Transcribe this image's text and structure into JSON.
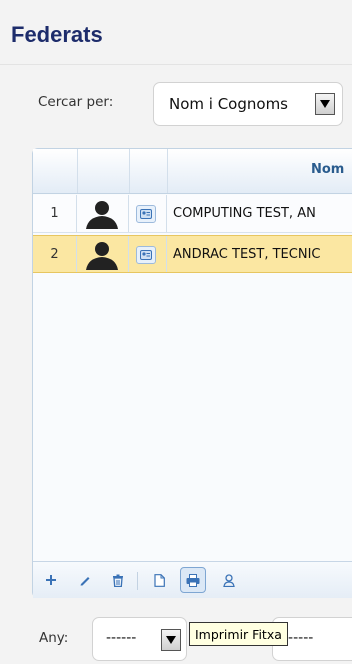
{
  "page": {
    "title": "Federats"
  },
  "search": {
    "label": "Cercar per:",
    "selected": "Nom i Cognoms"
  },
  "grid": {
    "column_header_name": "Nom",
    "rows": [
      {
        "num": "1",
        "name": "COMPUTING TEST, AN",
        "selected": false
      },
      {
        "num": "2",
        "name": "ANDRAC TEST, TECNIC",
        "selected": true
      }
    ]
  },
  "toolbar": {
    "icons": [
      "add-icon",
      "edit-icon",
      "delete-icon",
      "document-icon",
      "print-icon",
      "user-icon"
    ]
  },
  "filters": {
    "year_label": "Any:",
    "year_value": "------",
    "second_value": "------"
  },
  "tooltip": {
    "text": "Imprimir Fitxa"
  },
  "colors": {
    "title": "#1d2c6b",
    "selected_row": "#fbe7a2",
    "accent": "#2a6db5"
  }
}
